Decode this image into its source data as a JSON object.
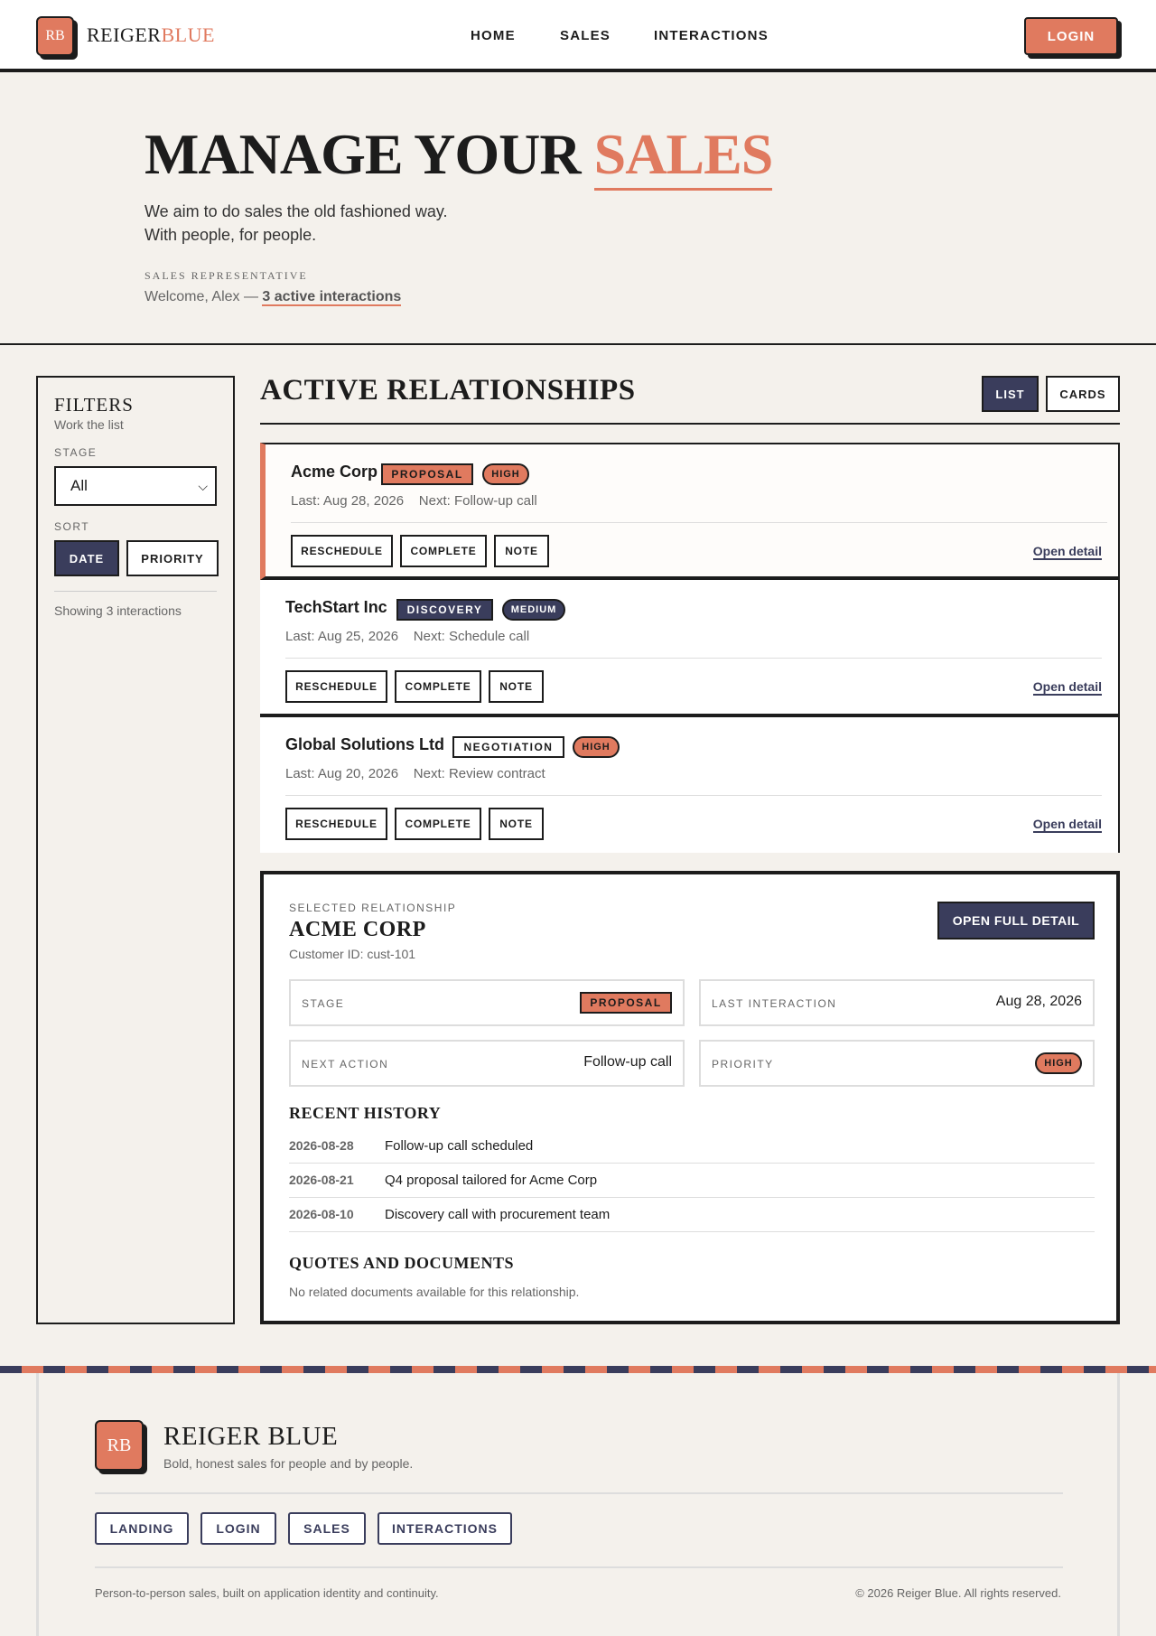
{
  "header": {
    "logo_mark": "RB",
    "brand_part1": "REIGER",
    "brand_part2": "BLUE",
    "nav": [
      "HOME",
      "SALES",
      "INTERACTIONS"
    ],
    "login_label": "LOGIN"
  },
  "hero": {
    "title_main": "MANAGE YOUR",
    "title_accent": "SALES",
    "subtitle_line1": "We aim to do sales the old fashioned way.",
    "subtitle_line2": "With people, for people.",
    "eyebrow": "SALES REPRESENTATIVE",
    "welcome_prefix": "Welcome, Alex —",
    "welcome_link": "3 active interactions"
  },
  "filters": {
    "title": "FILTERS",
    "subtitle": "Work the list",
    "stage_label": "STAGE",
    "stage_value": "All",
    "sort_label": "SORT",
    "sort_date": "DATE",
    "sort_priority": "PRIORITY",
    "showing": "Showing 3 interactions"
  },
  "main": {
    "title": "ACTIVE RELATIONSHIPS",
    "view_list": "LIST",
    "view_cards": "CARDS"
  },
  "relationships": [
    {
      "name": "Acme Corp",
      "stage": "PROPOSAL",
      "priority": "HIGH",
      "meta": "Last: Aug 28, 2026    Next: Follow-up call",
      "actions": [
        "RESCHEDULE",
        "COMPLETE",
        "NOTE"
      ],
      "open": "Open detail"
    },
    {
      "name": "TechStart Inc",
      "stage": "DISCOVERY",
      "priority": "MEDIUM",
      "meta": "Last: Aug 25, 2026    Next: Schedule call",
      "actions": [
        "RESCHEDULE",
        "COMPLETE",
        "NOTE"
      ],
      "open": "Open detail"
    },
    {
      "name": "Global Solutions Ltd",
      "stage": "NEGOTIATION",
      "priority": "HIGH",
      "meta": "Last: Aug 20, 2026    Next: Review contract",
      "actions": [
        "RESCHEDULE",
        "COMPLETE",
        "NOTE"
      ],
      "open": "Open detail"
    }
  ],
  "detail": {
    "eyebrow": "SELECTED RELATIONSHIP",
    "name": "ACME CORP",
    "customer_id": "Customer ID: cust-101",
    "open_full": "OPEN FULL DETAIL",
    "stage_label": "STAGE",
    "stage_value": "PROPOSAL",
    "last_label": "LAST INTERACTION",
    "last_value": "Aug 28, 2026",
    "next_label": "NEXT ACTION",
    "next_value": "Follow-up call",
    "priority_label": "PRIORITY",
    "priority_value": "HIGH",
    "history_title": "RECENT HISTORY",
    "history": [
      {
        "date": "2026-08-28",
        "text": "Follow-up call scheduled"
      },
      {
        "date": "2026-08-21",
        "text": "Q4 proposal tailored for Acme Corp"
      },
      {
        "date": "2026-08-10",
        "text": "Discovery call with procurement team"
      }
    ],
    "docs_title": "QUOTES AND DOCUMENTS",
    "docs_empty": "No related documents available for this relationship."
  },
  "footer": {
    "logo_mark": "RB",
    "name": "REIGER BLUE",
    "tagline": "Bold, honest sales for people and by people.",
    "links": [
      "LANDING",
      "LOGIN",
      "SALES",
      "INTERACTIONS"
    ],
    "left_note": "Person-to-person sales, built on application identity and continuity.",
    "copyright": "© 2026 Reiger Blue. All rights reserved."
  },
  "colors": {
    "accent": "#e07a5f",
    "navy": "#3a3d5c",
    "ink": "#1c1c1c",
    "paper": "#f4f1ec"
  }
}
